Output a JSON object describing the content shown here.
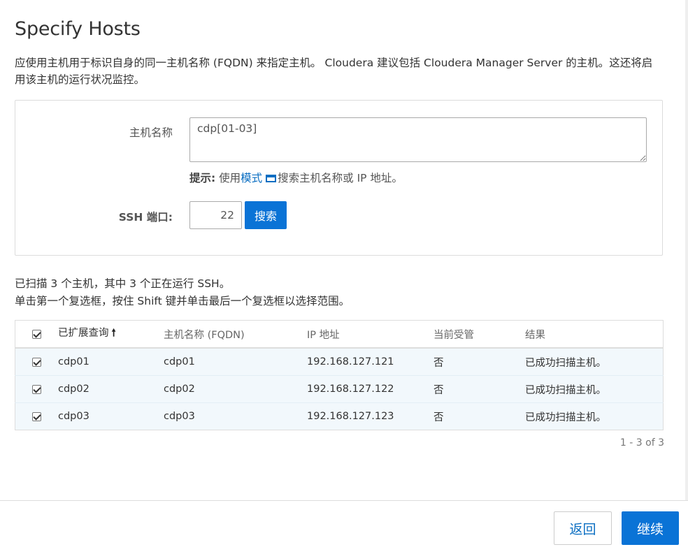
{
  "page": {
    "title": "Specify Hosts",
    "intro": "应使用主机用于标识自身的同一主机名称 (FQDN) 来指定主机。 Cloudera 建议包括 Cloudera Manager Server 的主机。这还将启用该主机的运行状况监控。"
  },
  "form": {
    "hostname_label": "主机名称",
    "hostname_value": "cdp[01-03]",
    "hint_strong": "提示:",
    "hint_prefix": " 使用",
    "hint_link": "模式",
    "hint_suffix": "搜索主机名称或 IP 地址。",
    "ssh_label": "SSH 端口:",
    "ssh_port": "22",
    "search_label": "搜索"
  },
  "scan": {
    "line1": "已扫描 3 个主机，其中 3 个正在运行 SSH。",
    "line2": "单击第一个复选框，按住 Shift 键并单击最后一个复选框以选择范围。"
  },
  "table": {
    "headers": {
      "expanded_query": "已扩展查询",
      "sort_arrow": "🠕",
      "fqdn": "主机名称 (FQDN)",
      "ip": "IP 地址",
      "managed": "当前受管",
      "result": "结果"
    },
    "rows": [
      {
        "expanded": "cdp01",
        "fqdn": "cdp01",
        "ip": "192.168.127.121",
        "managed": "否",
        "result": "已成功扫描主机。"
      },
      {
        "expanded": "cdp02",
        "fqdn": "cdp02",
        "ip": "192.168.127.122",
        "managed": "否",
        "result": "已成功扫描主机。"
      },
      {
        "expanded": "cdp03",
        "fqdn": "cdp03",
        "ip": "192.168.127.123",
        "managed": "否",
        "result": "已成功扫描主机。"
      }
    ],
    "pagination": "1 - 3 of 3"
  },
  "footer": {
    "back_label": "返回",
    "continue_label": "继续"
  },
  "colors": {
    "accent": "#0a73d6",
    "link": "#0a6ec2",
    "row_background": "#f2f8fc"
  },
  "icons": {
    "hint_popup": "popup-window-icon",
    "sort": "sort-ascending-icon"
  }
}
